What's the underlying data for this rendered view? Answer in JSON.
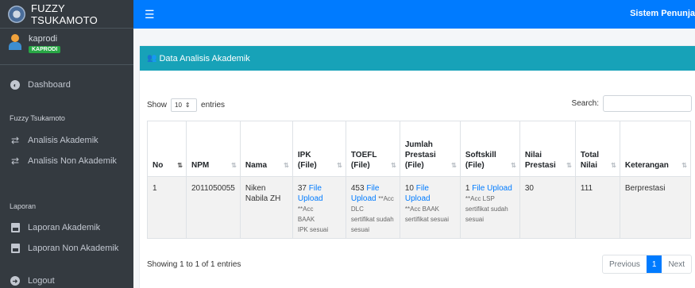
{
  "brand": {
    "title": "FUZZY TSUKAMOTO"
  },
  "user": {
    "name": "kaprodi",
    "role": "KAPRODI"
  },
  "sidebar": {
    "dashboard": "Dashboard",
    "section_fuzzy": "Fuzzy Tsukamoto",
    "analisis_akademik": "Analisis Akademik",
    "analisis_non_akademik": "Analisis Non Akademik",
    "section_laporan": "Laporan",
    "laporan_akademik": "Laporan Akademik",
    "laporan_non_akademik": "Laporan Non Akademik",
    "logout": "Logout"
  },
  "topbar": {
    "menu_icon": "☰",
    "title": "Sistem Penunja"
  },
  "card": {
    "title": "Data Analisis Akademik"
  },
  "controls": {
    "show": "Show",
    "page_size": "10",
    "entries": "entries",
    "search_label": "Search:",
    "search_value": ""
  },
  "table": {
    "headers": {
      "no": "No",
      "npm": "NPM",
      "nama": "Nama",
      "ipk_1": "IPK",
      "ipk_2": "(File)",
      "toefl_1": "TOEFL",
      "toefl_2": "(File)",
      "prestasi_1": "Jumlah",
      "prestasi_2": "Prestasi",
      "prestasi_3": "(File)",
      "softskill_1": "Softskill",
      "softskill_2": "(File)",
      "nilai_1": "Nilai",
      "nilai_2": "Prestasi",
      "total_1": "Total",
      "total_2": "Nilai",
      "keterangan": "Keterangan"
    },
    "row": {
      "no": "1",
      "npm": "2011050055",
      "nama_1": "Niken",
      "nama_2": "Nabila ZH",
      "ipk_value": "37",
      "ipk_link_1": "File",
      "ipk_link_2": "Upload",
      "ipk_note_1": "**Acc",
      "ipk_note_2": "BAAK",
      "ipk_note_3": "IPK sesuai",
      "toefl_value": "453",
      "toefl_link_1": "File",
      "toefl_link_2": "Upload",
      "toefl_note_1": "**Acc",
      "toefl_note_2": "DLC",
      "toefl_note_3": "sertifikat sudah",
      "toefl_note_4": "sesuai",
      "prestasi_value": "10",
      "prestasi_link": "File Upload",
      "prestasi_note_1": "**Acc BAAK",
      "prestasi_note_2": "sertifikat sesuai",
      "softskill_value": "1",
      "softskill_link": "File Upload",
      "softskill_note_1": "**Acc LSP",
      "softskill_note_2": "sertifikat sudah",
      "softskill_note_3": "sesuai",
      "nilai_prestasi": "30",
      "total_nilai": "111",
      "keterangan": "Berprestasi"
    }
  },
  "footer": {
    "info": "Showing 1 to 1 of 1 entries",
    "prev": "Previous",
    "page": "1",
    "next": "Next"
  },
  "colors": {
    "sidebar": "#343a40",
    "topbar": "#007bff",
    "card_header": "#17a2b8",
    "role_badge": "#28a745",
    "link": "#007bff"
  }
}
